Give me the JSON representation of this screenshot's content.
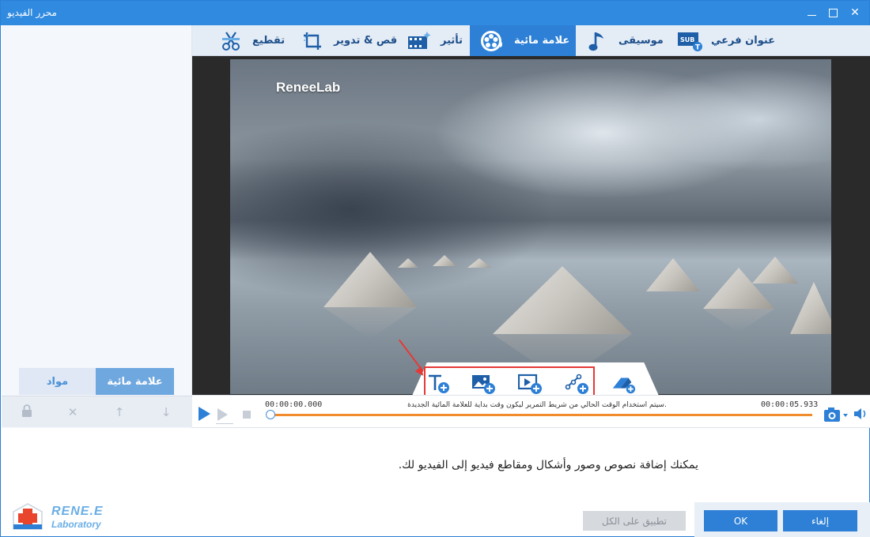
{
  "window": {
    "title": "محرر الفيديو"
  },
  "tabs": [
    {
      "label": "تقطيع",
      "icon": "trim-icon"
    },
    {
      "label": "قص & تدوير",
      "icon": "crop-rotate-icon"
    },
    {
      "label": "تأثير",
      "icon": "effect-icon"
    },
    {
      "label": "علامة مائية",
      "icon": "watermark-icon",
      "active": true
    },
    {
      "label": "موسيقى",
      "icon": "music-icon"
    },
    {
      "label": "عنوان فرعي",
      "icon": "subtitle-icon"
    }
  ],
  "left_panel": {
    "tabs": {
      "watermark": "علامة مائية",
      "materials": "مواد"
    },
    "tools": [
      "lock-icon",
      "close-icon",
      "arrow-up-icon",
      "arrow-down-icon"
    ]
  },
  "video": {
    "watermark_text": "ReneeLab"
  },
  "watermark_tools": [
    "add-text-icon",
    "add-image-icon",
    "add-video-icon",
    "add-shape-icon",
    "eraser-icon"
  ],
  "timeline": {
    "current_time": "00:00:00.000",
    "end_time": "00:00:05.933",
    "hint": "سيتم استخدام الوقت الحالي من شريط التمرير ليكون وقت بداية للعلامة المائية الجديدة.",
    "progress": 0
  },
  "description": "يمكنك إضافة نصوص وصور وأشكال ومقاطع فيديو إلى الفيديو لك.",
  "logo": {
    "line1": "RENE.E",
    "line2": "Laboratory"
  },
  "buttons": {
    "apply_all": "تطبيق على الكل",
    "ok": "OK",
    "cancel": "إلغاء"
  },
  "colors": {
    "accent": "#2d80d6",
    "highlight_box": "#e53935",
    "progress": "#f08c2b"
  }
}
